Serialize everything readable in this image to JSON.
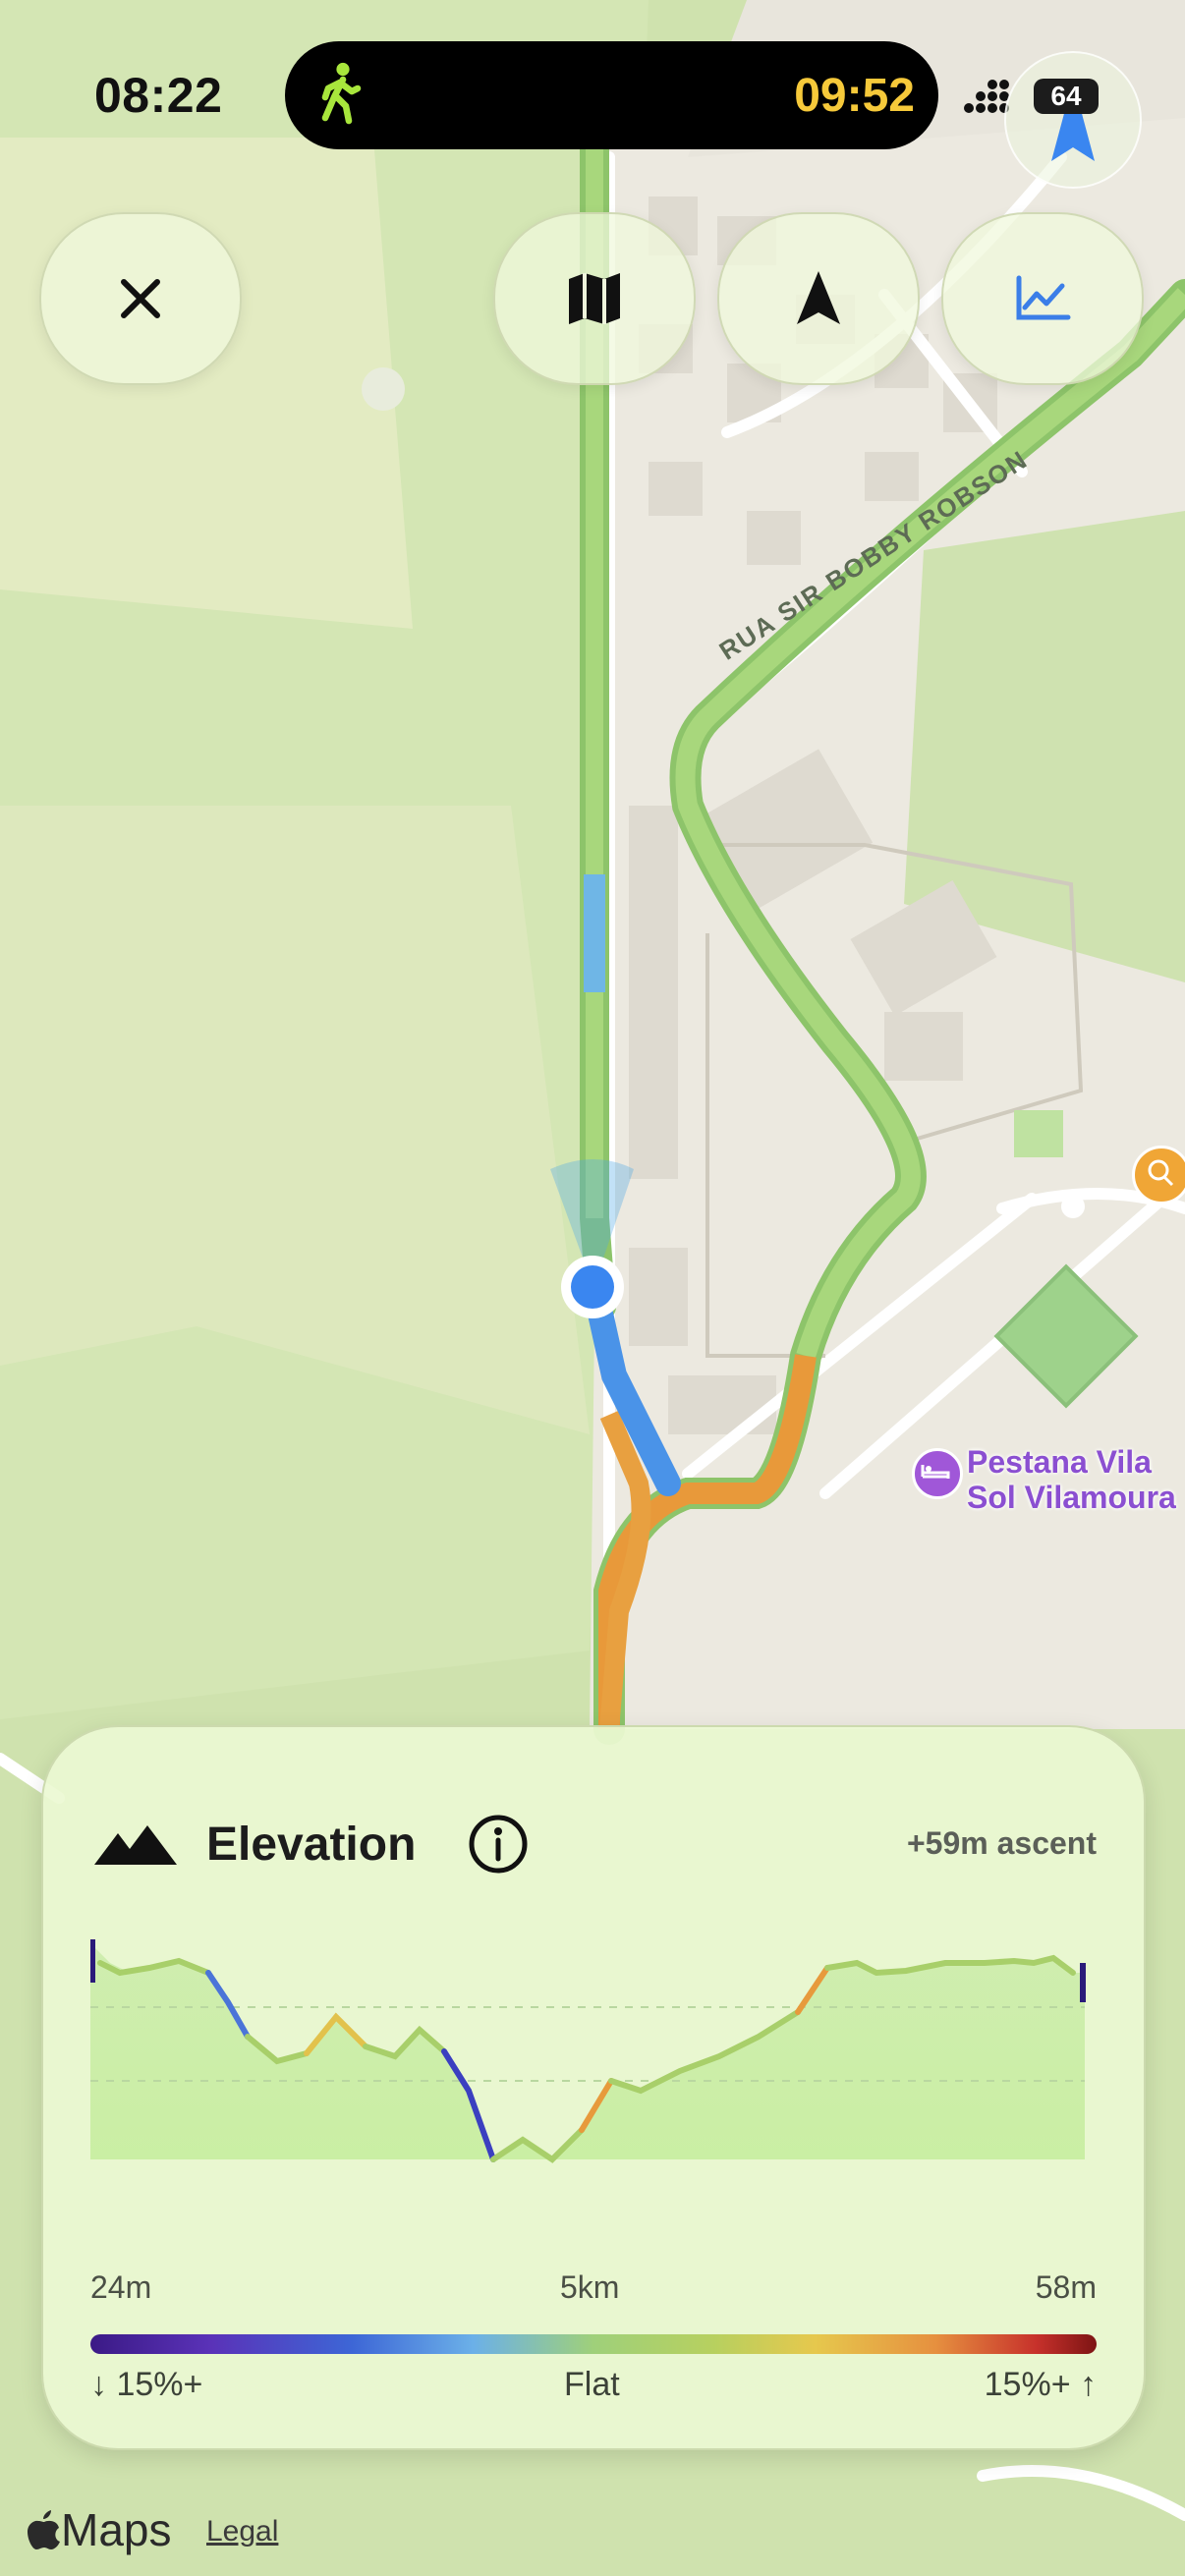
{
  "status_bar": {
    "time": "08:22",
    "activity_timer": "09:52",
    "battery": "64"
  },
  "map": {
    "street_name": "RUA SIR BOBBY ROBSON",
    "poi_name_line1": "Pestana Vila",
    "poi_name_line2": "Sol Vilamoura"
  },
  "controls": {
    "close_icon": "close-icon",
    "map_icon": "map-icon",
    "navigation_icon": "navigation-arrow-icon",
    "chart_icon": "chart-icon",
    "compass_icon": "compass-icon"
  },
  "elevation_panel": {
    "title": "Elevation",
    "ascent": "+59m ascent",
    "axis_left": "24m",
    "axis_center": "5km",
    "axis_right": "58m",
    "legend_left": "↓ 15%+",
    "legend_center": "Flat",
    "legend_right": "15%+ ↑"
  },
  "footer": {
    "brand": "Maps",
    "legal": "Legal"
  }
}
